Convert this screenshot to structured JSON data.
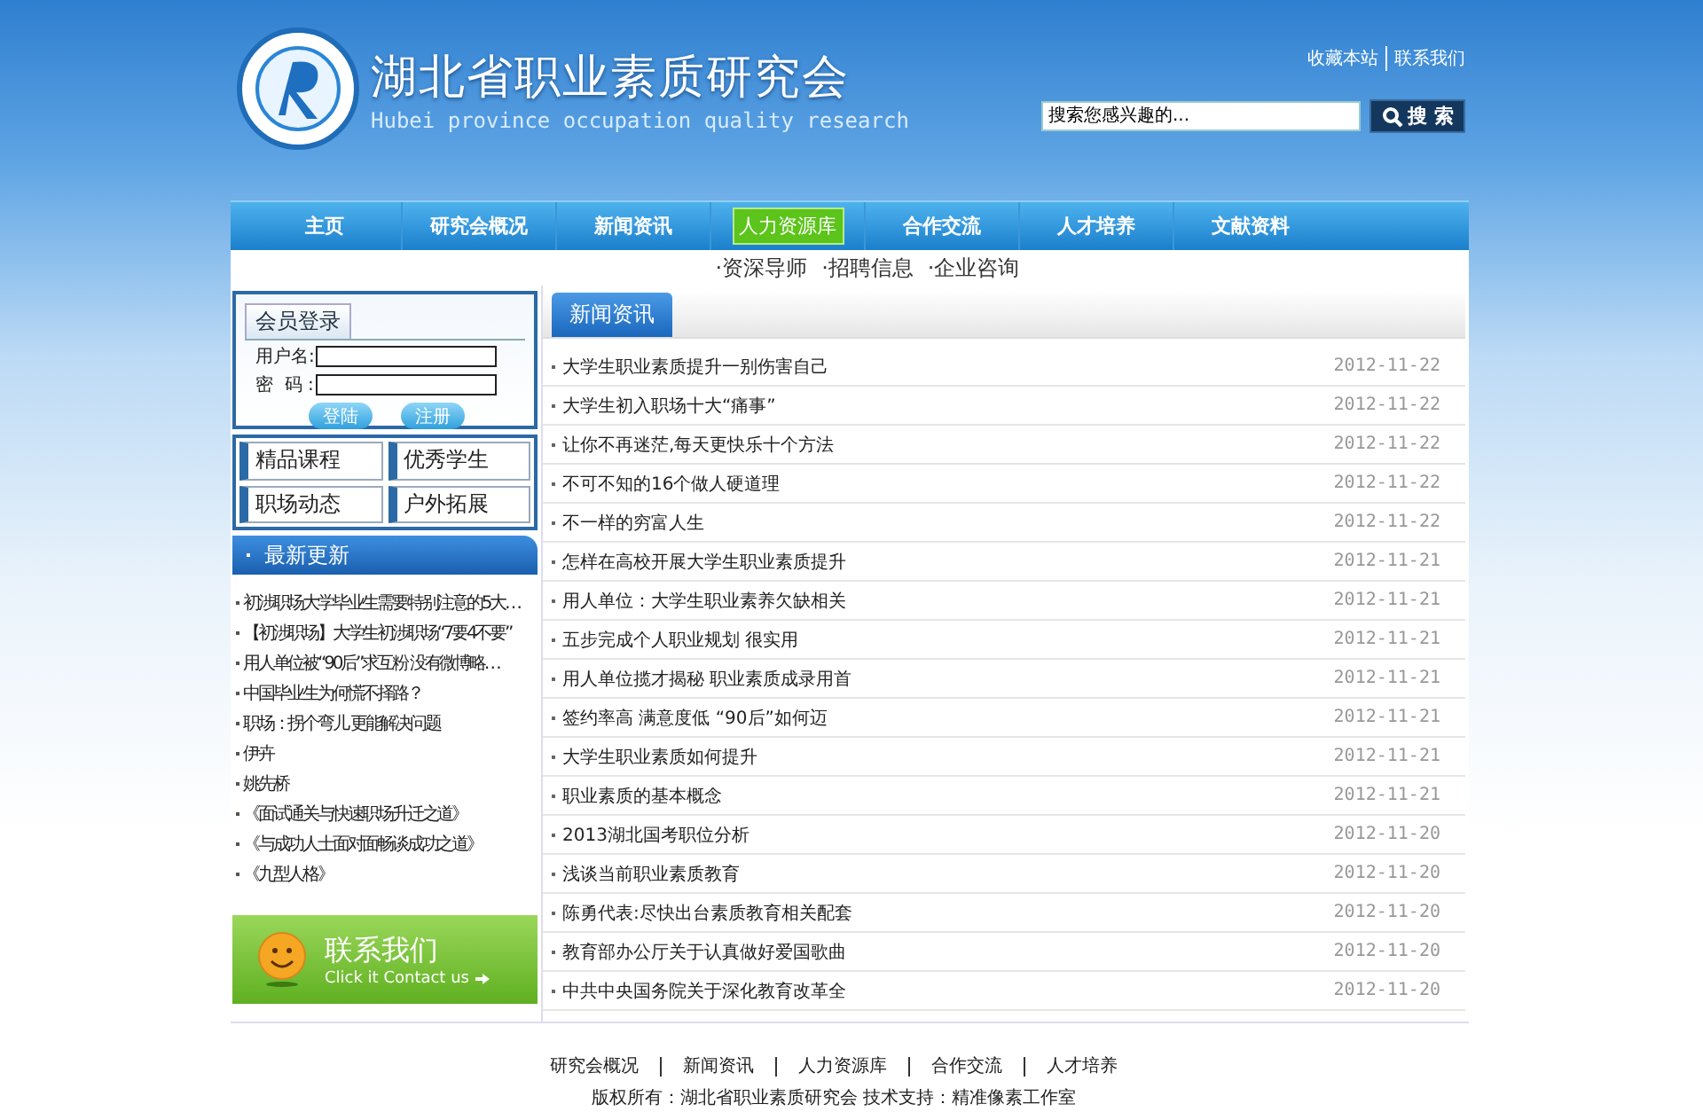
{
  "header": {
    "title": "湖北省职业素质研究会",
    "subtitle": "Hubei province occupation quality research",
    "top_links": [
      "收藏本站",
      "联系我们"
    ],
    "search": {
      "placeholder": "搜索您感兴趣的...",
      "button": "搜 索"
    }
  },
  "nav": [
    {
      "label": "主页",
      "selected": false
    },
    {
      "label": "研究会概况",
      "selected": false
    },
    {
      "label": "新闻资讯",
      "selected": false
    },
    {
      "label": "人力资源库",
      "selected": true
    },
    {
      "label": "合作交流",
      "selected": false
    },
    {
      "label": "人才培养",
      "selected": false
    },
    {
      "label": "文献资料",
      "selected": false
    }
  ],
  "subnav": [
    "·资深导师",
    "·招聘信息",
    "·企业咨询"
  ],
  "login": {
    "tab": "会员登录",
    "fields": [
      "用户名:",
      "密  码 :"
    ],
    "buttons": [
      "登陆",
      "注册"
    ]
  },
  "quick_links": [
    "精品课程",
    "优秀学生",
    "职场动态",
    "户外拓展"
  ],
  "latest": {
    "title": "最新更新",
    "items": [
      "初涉职场大学毕业生需要特别注意的5大…",
      "【初涉职场】大学生初涉职场“7要4不要”",
      "用人单位被“90后”求互粉 没有微博略…",
      "中国毕业生为何慌不择路？",
      "职场：拐个弯儿 更能解决问题",
      "伊卉",
      "姚先桥",
      "《面试通关与快速职场升迁之道》",
      "《与成功人士面对面畅谈成功之道》",
      "《九型人格》"
    ]
  },
  "contact": {
    "title": "联系我们",
    "subtitle": "Click it Contact us"
  },
  "news": {
    "title": "新闻资讯",
    "rows": [
      {
        "title": "大学生职业素质提升一别伤害自己",
        "date": "2012-11-22"
      },
      {
        "title": "大学生初入职场十大“痛事”",
        "date": "2012-11-22"
      },
      {
        "title": "让你不再迷茫,每天更快乐十个方法",
        "date": "2012-11-22"
      },
      {
        "title": "不可不知的16个做人硬道理",
        "date": "2012-11-22"
      },
      {
        "title": "不一样的穷富人生",
        "date": "2012-11-22"
      },
      {
        "title": "怎样在高校开展大学生职业素质提升",
        "date": "2012-11-21"
      },
      {
        "title": "用人单位：大学生职业素养欠缺相关",
        "date": "2012-11-21"
      },
      {
        "title": "五步完成个人职业规划 很实用",
        "date": "2012-11-21"
      },
      {
        "title": "用人单位揽才揭秘 职业素质成录用首",
        "date": "2012-11-21"
      },
      {
        "title": "签约率高 满意度低 “90后”如何迈",
        "date": "2012-11-21"
      },
      {
        "title": "大学生职业素质如何提升",
        "date": "2012-11-21"
      },
      {
        "title": "职业素质的基本概念",
        "date": "2012-11-21"
      },
      {
        "title": "2013湖北国考职位分析",
        "date": "2012-11-20"
      },
      {
        "title": "浅谈当前职业素质教育",
        "date": "2012-11-20"
      },
      {
        "title": "陈勇代表:尽快出台素质教育相关配套",
        "date": "2012-11-20"
      },
      {
        "title": "教育部办公厅关于认真做好爱国歌曲",
        "date": "2012-11-20"
      },
      {
        "title": "中共中央国务院关于深化教育改革全",
        "date": "2012-11-20"
      }
    ]
  },
  "footer": {
    "links": [
      "研究会概况",
      "新闻资讯",
      "人力资源库",
      "合作交流",
      "人才培养"
    ],
    "copyright": "版权所有：湖北省职业素质研究会 技术支持：精准像素工作室"
  }
}
